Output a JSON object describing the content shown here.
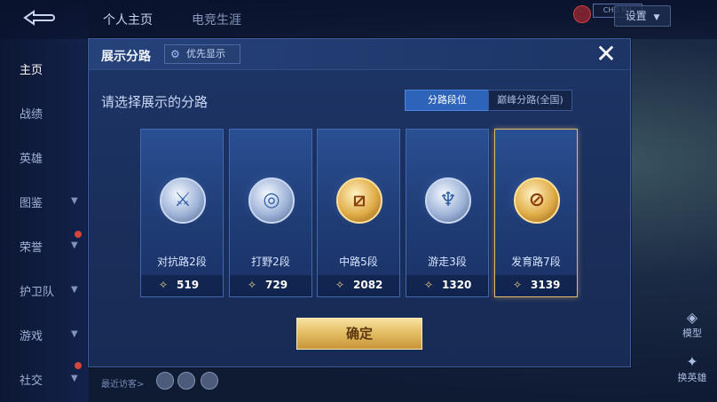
{
  "topbar": {
    "tabs": [
      "个人主页",
      "电竞生涯"
    ],
    "settings_label": "设置",
    "badge_text": "CHO M4"
  },
  "sidebar": {
    "items": [
      {
        "label": "主页",
        "active": true
      },
      {
        "label": "战绩",
        "active": false
      },
      {
        "label": "英雄",
        "active": false
      },
      {
        "label": "图鉴",
        "active": false
      },
      {
        "label": "荣誉",
        "active": false
      },
      {
        "label": "护卫队",
        "active": false
      },
      {
        "label": "游戏",
        "active": false
      },
      {
        "label": "社交",
        "active": false
      }
    ]
  },
  "recent_visitors_label": "最近访客>",
  "right_side": {
    "model_label": "模型",
    "switch_hero_label": "换英雄"
  },
  "modal": {
    "title": "展示分路",
    "priority_label": "优先显示",
    "close_symbol": "✕",
    "subtitle": "请选择展示的分路",
    "segments": [
      {
        "label": "分路段位",
        "active": true
      },
      {
        "label": "巅峰分路(全国)",
        "active": false
      }
    ],
    "cards": [
      {
        "label": "对抗路2段",
        "points": "519",
        "emblem": "silver",
        "icon": "sword-clash-icon",
        "selected": false
      },
      {
        "label": "打野2段",
        "points": "729",
        "emblem": "silver",
        "icon": "swirl-icon",
        "selected": false
      },
      {
        "label": "中路5段",
        "points": "2082",
        "emblem": "gold",
        "icon": "slash-icon",
        "selected": false
      },
      {
        "label": "游走3段",
        "points": "1320",
        "emblem": "silver",
        "icon": "wings-icon",
        "selected": false
      },
      {
        "label": "发育路7段",
        "points": "3139",
        "emblem": "gold",
        "icon": "forbidden-circle-icon",
        "selected": true
      }
    ],
    "confirm_label": "确定"
  },
  "colors": {
    "modal_bg": "#1d3566",
    "active_segment": "#2d63b8",
    "gold_button": "#e5bf66",
    "selected_border": "#e2b86b"
  }
}
